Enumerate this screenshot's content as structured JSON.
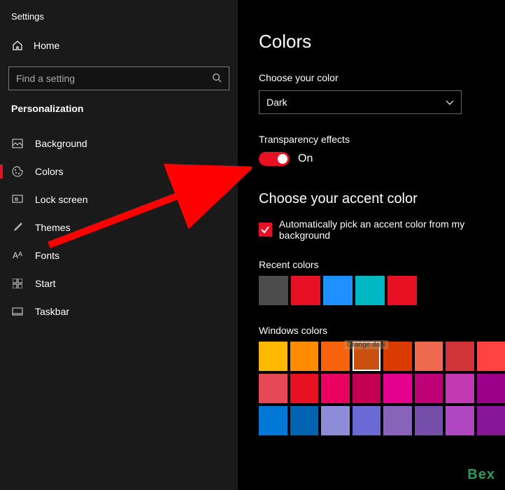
{
  "app_title": "Settings",
  "home_label": "Home",
  "search_placeholder": "Find a setting",
  "section_label": "Personalization",
  "nav": [
    {
      "label": "Background"
    },
    {
      "label": "Colors"
    },
    {
      "label": "Lock screen"
    },
    {
      "label": "Themes"
    },
    {
      "label": "Fonts"
    },
    {
      "label": "Start"
    },
    {
      "label": "Taskbar"
    }
  ],
  "page_title": "Colors",
  "choose_color_label": "Choose your color",
  "mode_value": "Dark",
  "transparency_label": "Transparency effects",
  "transparency_state": "On",
  "accent_title": "Choose your accent color",
  "auto_pick_label": "Automatically pick an accent color from my background",
  "recent_label": "Recent colors",
  "recent_colors": [
    "#4c4c4c",
    "#e81123",
    "#1e90ff",
    "#00b7c3",
    "#e81123"
  ],
  "windows_label": "Windows colors",
  "windows_colors": [
    [
      "#ffb900",
      "#ff8c00",
      "#f7630c",
      "#ca5010",
      "#da3b01",
      "#ef6950",
      "#d13438",
      "#ff4343"
    ],
    [
      "#e74856",
      "#e81123",
      "#ea005e",
      "#c30052",
      "#e3008c",
      "#bf0077",
      "#c239b3",
      "#9a0089"
    ],
    [
      "#0078d7",
      "#0063b1",
      "#8e8cd8",
      "#6b69d6",
      "#8764b8",
      "#744da9",
      "#b146c2",
      "#881798"
    ]
  ],
  "selected_swatch_tooltip": "Orange dark",
  "watermark": "Bex"
}
